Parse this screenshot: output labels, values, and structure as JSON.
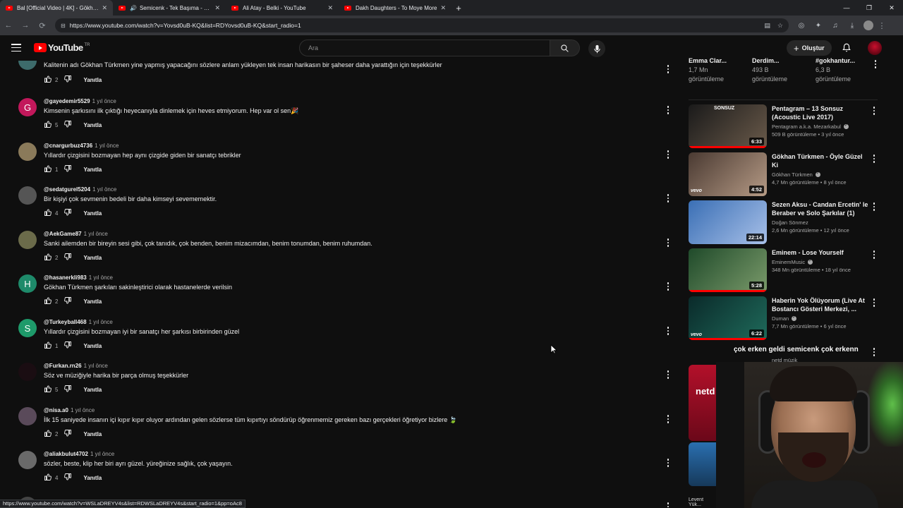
{
  "browser": {
    "tabs": [
      {
        "title": "Bal [Official Video | 4K] - Gökhan",
        "active": true,
        "audio": false
      },
      {
        "title": "Semicenk - Tek Başıma - You",
        "active": false,
        "audio": true
      },
      {
        "title": "Ali Atay - Belki - YouTube",
        "active": false,
        "audio": false
      },
      {
        "title": "Dakh Daughters - To Moye More",
        "active": false,
        "audio": false
      }
    ],
    "url": "https://www.youtube.com/watch?v=Yovsd0uB-KQ&list=RDYovsd0uB-KQ&start_radio=1",
    "status_url": "https://www.youtube.com/watch?v=WSLaDREYV4s&list=RDWSLaDREYV4s&start_radio=1&pp=oAc8"
  },
  "header": {
    "logo_text": "YouTube",
    "country": "TR",
    "search_placeholder": "Ara",
    "create_label": "Oluştur"
  },
  "comments": [
    {
      "handle": "",
      "time": "",
      "text": "Kalitenin adı Gökhan Türkmen yine yapmış yapacağını sözlere anlam yükleyen tek insan harikasın bir şaheser daha yarattığın için teşekkürler",
      "likes": "2",
      "reply": "Yanıtla",
      "avatar": "",
      "avatar_color": "#3d6b6b"
    },
    {
      "handle": "@gayedemir5529",
      "time": "1 yıl önce",
      "text": "Kimsenin şarkısını ilk çıktığı heyecanıyla dinlemek için heves etmiyorum. Hep var ol sen🎉",
      "likes": "5",
      "reply": "Yanıtla",
      "avatar": "G",
      "avatar_color": "#c2185b"
    },
    {
      "handle": "@cnargurbuz4736",
      "time": "1 yıl önce",
      "text": "Yıllardır çizgisini bozmayan hep aynı çizgide giden bir sanatçı tebrikler",
      "likes": "1",
      "reply": "Yanıtla",
      "avatar": "",
      "avatar_color": "#8a7a5a"
    },
    {
      "handle": "@sedatgurel5204",
      "time": "1 yıl önce",
      "text": "Bir kişiyi çok sevmenin bedeli bir daha kimseyi sevememektir.",
      "likes": "4",
      "reply": "Yanıtla",
      "avatar": "",
      "avatar_color": "#555555"
    },
    {
      "handle": "@AekGame87",
      "time": "1 yıl önce",
      "text": "Sanki ailemden bir bireyin sesi gibi, çok tanıdık, çok benden, benim mizacımdan, benim tonumdan, benim ruhumdan.",
      "likes": "2",
      "reply": "Yanıtla",
      "avatar": "",
      "avatar_color": "#6b6b4a"
    },
    {
      "handle": "@hasanerkli983",
      "time": "1 yıl önce",
      "text": "Gökhan Türkmen şarkıları sakinleştirici olarak hastanelerde verilsin",
      "likes": "2",
      "reply": "Yanıtla",
      "avatar": "H",
      "avatar_color": "#1e8a6a"
    },
    {
      "handle": "@Turkeyball468",
      "time": "1 yıl önce",
      "text": "Yıllardır çizgisini bozmayan iyi bir sanatçı her şarkısı birbirinden güzel",
      "likes": "1",
      "reply": "Yanıtla",
      "avatar": "S",
      "avatar_color": "#1e9a6a"
    },
    {
      "handle": "@Furkan.rn26",
      "time": "1 yıl önce",
      "text": "Söz ve müziğiyle harika bir parça olmuş teşekkürler",
      "likes": "5",
      "reply": "Yanıtla",
      "avatar": "",
      "avatar_color": "#1a0d12"
    },
    {
      "handle": "@nisa.a0",
      "time": "1 yıl önce",
      "text": "İlk 15 saniyede insanın içi kıpır kıpır oluyor ardından gelen sözlerse tüm kıpırtıyı söndürüp öğrenmemiz gereken bazı gerçekleri öğretiyor bizlere 🍃",
      "likes": "2",
      "reply": "Yanıtla",
      "avatar": "",
      "avatar_color": "#5a4a5a"
    },
    {
      "handle": "@aliakbulut4702",
      "time": "1 yıl önce",
      "text": "sözler, beste, klip her biri ayrı güzel. yüreğinize sağlık, çok yaşayın.",
      "likes": "4",
      "reply": "Yanıtla",
      "avatar": "",
      "avatar_color": "#6a6a6a"
    }
  ],
  "top_recs": [
    {
      "title": "Emma Clar...",
      "views": "1,7 Mn",
      "label": "görüntüleme"
    },
    {
      "title": "Derdim...",
      "views": "493 B",
      "label": "görüntüleme"
    },
    {
      "title": "#gokhantur...",
      "views": "6,3 B",
      "label": "görüntüleme"
    }
  ],
  "recommendations": [
    {
      "title": "Pentagram – 13 Sonsuz (Acoustic Live 2017)",
      "channel": "Pentagram a.k.a. Mezarkabul",
      "verified": true,
      "meta": "509 B görüntüleme • 3 yıl önce",
      "duration": "6:33",
      "progress": 1.0,
      "thumb_colors": [
        "#1a1a1a",
        "#6a5a4a"
      ],
      "thumb_text": "SONSUZ",
      "vevo": false
    },
    {
      "title": "Gökhan Türkmen - Öyle Güzel Ki",
      "channel": "Gökhan Türkmen",
      "verified": true,
      "meta": "4,7 Mn görüntüleme • 8 yıl önce",
      "duration": "4:52",
      "progress": 0.0,
      "thumb_colors": [
        "#4a3a32",
        "#b59a85"
      ],
      "thumb_text": "",
      "vevo": true
    },
    {
      "title": "Sezen Aksu - Candan Ercetin' le Beraber ve Solo Şarkılar (1)",
      "channel": "Doğan Sönmez",
      "verified": false,
      "meta": "2,6 Mn görüntüleme • 12 yıl önce",
      "duration": "22:14",
      "progress": 0.0,
      "thumb_colors": [
        "#3a6fb5",
        "#a8c0e8"
      ],
      "thumb_text": "",
      "vevo": false
    },
    {
      "title": "Eminem - Lose Yourself",
      "channel": "EminemMusic",
      "verified": true,
      "meta": "348 Mn görüntüleme • 18 yıl önce",
      "duration": "5:28",
      "progress": 1.0,
      "thumb_colors": [
        "#1f4a2a",
        "#7a9a6a"
      ],
      "thumb_text": "",
      "vevo": false
    },
    {
      "title": "Haberin Yok Ölüyorum (Live At Bostancı Gösteri Merkezi, ...",
      "channel": "Duman",
      "verified": true,
      "meta": "7,7 Mn görüntüleme • 6 yıl önce",
      "duration": "6:22",
      "progress": 1.0,
      "thumb_colors": [
        "#0a2a2a",
        "#1f6a5a"
      ],
      "thumb_text": "",
      "vevo": true
    }
  ],
  "overlay": {
    "caption": "çok erken geldi semicenk çok erkenn",
    "partial_channel": "netd müzik",
    "partial_brand": "netd",
    "partial_bottom": "Levent Yük..."
  },
  "colors": {
    "accent": "#ff0000",
    "background": "#0f0f0f"
  }
}
